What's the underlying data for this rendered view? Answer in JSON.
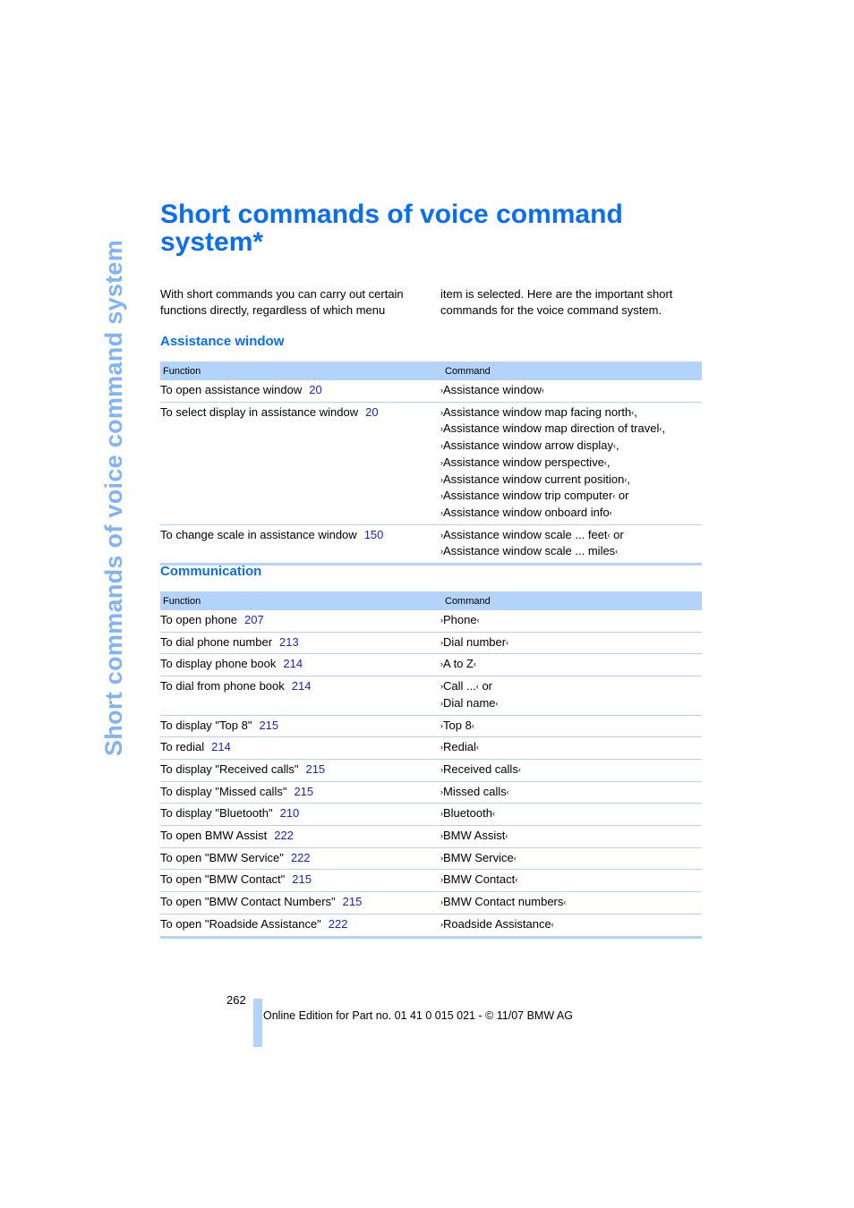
{
  "side_title": "Short commands of voice command system",
  "page_title": "Short commands of voice command system*",
  "intro": {
    "left": "With short commands you can carry out certain functions directly, regardless of which menu",
    "right": "item is selected. Here are the important short commands for the voice command system."
  },
  "sections": [
    {
      "heading": "Assistance window",
      "columns": [
        "Function",
        "Command"
      ],
      "rows": [
        {
          "function": "To open assistance window",
          "page": "20",
          "commands": [
            "Assistance window"
          ],
          "suffixes": [
            ""
          ]
        },
        {
          "function": "To select display in assistance window",
          "page": "20",
          "commands": [
            "Assistance window map facing north",
            "Assistance window map direction of travel",
            "Assistance window arrow display",
            "Assistance window perspective",
            "Assistance window current position",
            "Assistance window trip computer",
            "Assistance window onboard info"
          ],
          "suffixes": [
            ",",
            ",",
            ",",
            ",",
            ",",
            " or",
            ""
          ]
        },
        {
          "function": "To change scale in assistance window",
          "page": "150",
          "commands": [
            "Assistance window scale ... feet",
            "Assistance window scale ... miles"
          ],
          "suffixes": [
            " or",
            ""
          ]
        }
      ]
    },
    {
      "heading": "Communication",
      "columns": [
        "Function",
        "Command"
      ],
      "rows": [
        {
          "function": "To open phone",
          "page": "207",
          "commands": [
            "Phone"
          ],
          "suffixes": [
            ""
          ]
        },
        {
          "function": "To dial phone number",
          "page": "213",
          "commands": [
            "Dial number"
          ],
          "suffixes": [
            ""
          ]
        },
        {
          "function": "To display phone book",
          "page": "214",
          "commands": [
            "A to Z"
          ],
          "suffixes": [
            ""
          ]
        },
        {
          "function": "To dial from phone book",
          "page": "214",
          "commands": [
            "Call ...",
            "Dial name"
          ],
          "suffixes": [
            " or",
            ""
          ]
        },
        {
          "function": "To display \"Top 8\"",
          "page": "215",
          "commands": [
            "Top 8"
          ],
          "suffixes": [
            ""
          ]
        },
        {
          "function": "To redial",
          "page": "214",
          "commands": [
            "Redial"
          ],
          "suffixes": [
            ""
          ]
        },
        {
          "function": "To display \"Received calls\"",
          "page": "215",
          "commands": [
            "Received calls"
          ],
          "suffixes": [
            ""
          ]
        },
        {
          "function": "To display \"Missed calls\"",
          "page": "215",
          "commands": [
            "Missed calls"
          ],
          "suffixes": [
            ""
          ]
        },
        {
          "function": "To display \"Bluetooth\"",
          "page": "210",
          "commands": [
            "Bluetooth"
          ],
          "suffixes": [
            ""
          ]
        },
        {
          "function": "To open BMW Assist",
          "page": "222",
          "commands": [
            "BMW Assist"
          ],
          "suffixes": [
            ""
          ]
        },
        {
          "function": "To open \"BMW Service\"",
          "page": "222",
          "commands": [
            "BMW Service"
          ],
          "suffixes": [
            ""
          ]
        },
        {
          "function": "To open \"BMW Contact\"",
          "page": "215",
          "commands": [
            "BMW Contact"
          ],
          "suffixes": [
            ""
          ]
        },
        {
          "function": "To open \"BMW Contact Numbers\"",
          "page": "215",
          "commands": [
            "BMW Contact numbers"
          ],
          "suffixes": [
            ""
          ]
        },
        {
          "function": "To open \"Roadside Assistance\"",
          "page": "222",
          "commands": [
            "Roadside Assistance"
          ],
          "suffixes": [
            ""
          ]
        }
      ]
    }
  ],
  "quote_open": "›",
  "quote_close": "‹",
  "footer": {
    "page_number": "262",
    "edition_text": "Online Edition for Part no. 01 41 0 015 021 - © 11/07 BMW AG"
  },
  "colors": {
    "title_blue": "#0a6ef0",
    "side_title_blue": "#80b4f4",
    "table_header_bg": "#b3d3fb",
    "page_link_blue": "#1a22d8"
  }
}
